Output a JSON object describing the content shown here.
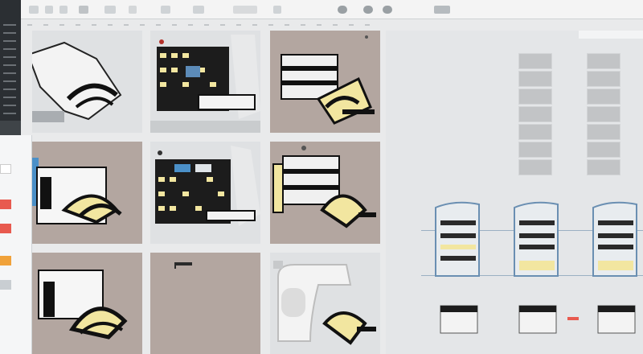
{
  "app": {
    "preview_title": "",
    "colors": {
      "tile_beige": "#b3a6a0",
      "tile_light": "#dfe1e3",
      "accent_red": "#e85a4f",
      "accent_orange": "#f0a23a",
      "accent_blue": "#4b90c8",
      "yellow": "#f2e6a0"
    }
  },
  "toolbar": {
    "icons": [
      "toolbar-icon-1",
      "toolbar-icon-2",
      "toolbar-icon-3",
      "toolbar-icon-4",
      "toolbar-icon-5",
      "toolbar-icon-6",
      "toolbar-icon-7",
      "toolbar-icon-8",
      "toolbar-icon-9",
      "toolbar-icon-10",
      "toolbar-icon-11",
      "toolbar-icon-12",
      "toolbar-icon-13",
      "toolbar-icon-14"
    ]
  },
  "palette": {
    "swatches": [
      "#ffffff",
      "#e85a4f",
      "#e85a4f",
      "#f0a23a",
      "#c9ced2"
    ]
  },
  "grid": {
    "tiles": [
      {
        "name": "tile-1",
        "bg": "light",
        "kind": "fridge-white"
      },
      {
        "name": "tile-2",
        "bg": "light",
        "kind": "shelves-dark"
      },
      {
        "name": "tile-3",
        "bg": "beige",
        "kind": "cooker-yellow"
      },
      {
        "name": "tile-4",
        "bg": "beige",
        "kind": "fridge-yellow"
      },
      {
        "name": "tile-5",
        "bg": "light",
        "kind": "shelves-blue"
      },
      {
        "name": "tile-6",
        "bg": "beige",
        "kind": "cooker-yellow"
      },
      {
        "name": "tile-7",
        "bg": "beige",
        "kind": "fridge-yellow"
      },
      {
        "name": "tile-8",
        "bg": "beige",
        "kind": "empty"
      },
      {
        "name": "tile-9",
        "bg": "light",
        "kind": "oven-white"
      }
    ]
  },
  "preview": {
    "cells_rows": 7,
    "units": [
      "unit-1",
      "unit-2",
      "unit-3"
    ]
  }
}
